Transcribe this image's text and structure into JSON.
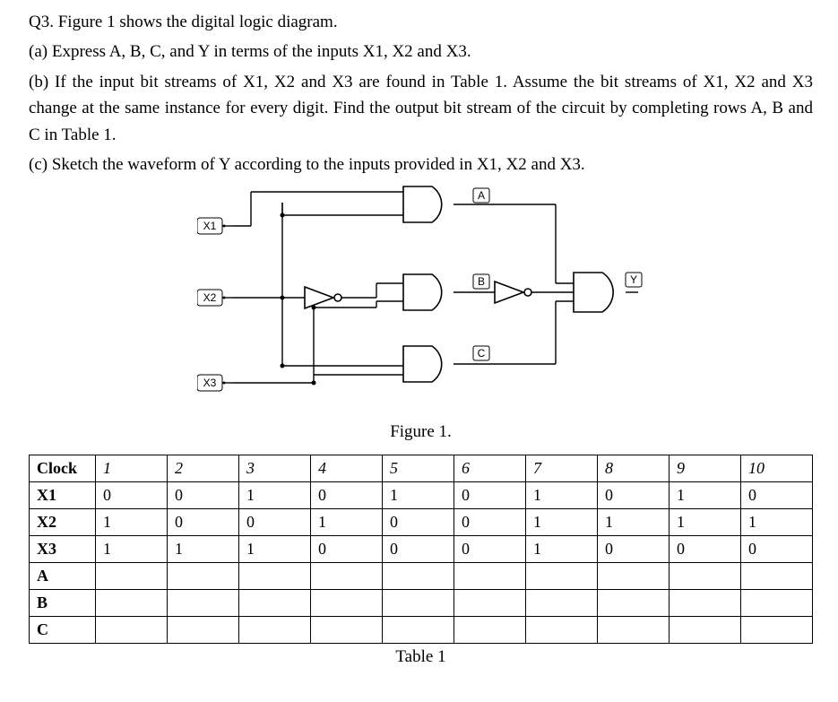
{
  "text": {
    "q_intro": "Q3. Figure 1 shows the digital logic diagram.",
    "part_a": "(a) Express A, B, C, and Y in terms of the inputs X1, X2 and X3.",
    "part_b": "(b) If the input bit streams of X1, X2 and X3 are found in Table 1. Assume the bit streams of X1, X2 and X3 change at the same instance for every digit. Find the output bit stream of the circuit by completing rows A, B and C in Table 1.",
    "part_c": "(c) Sketch the waveform of Y according to the inputs provided in X1, X2 and X3.",
    "fig_caption": "Figure 1.",
    "table_caption": "Table 1"
  },
  "diagram": {
    "inputs": {
      "x1": "X1",
      "x2": "X2",
      "x3": "X3"
    },
    "nodes": {
      "a": "A",
      "b": "B",
      "c": "C",
      "y": "Y"
    },
    "gates": {
      "not_x2": "NOT",
      "and_top": "AND2",
      "and_mid": "AND2",
      "and_bot": "AND2",
      "not_b": "NOT",
      "and_final": "AND3"
    },
    "connections_note": "A = X1·X2; B = X2'·X3; C = X2·X3; final inputs = A, B', C → Y"
  },
  "table": {
    "headers": [
      "Clock",
      "1",
      "2",
      "3",
      "4",
      "5",
      "6",
      "7",
      "8",
      "9",
      "10"
    ],
    "rows": [
      {
        "label": "X1",
        "cells": [
          "0",
          "0",
          "1",
          "0",
          "1",
          "0",
          "1",
          "0",
          "1",
          "0"
        ]
      },
      {
        "label": "X2",
        "cells": [
          "1",
          "0",
          "0",
          "1",
          "0",
          "0",
          "1",
          "1",
          "1",
          "1"
        ]
      },
      {
        "label": "X3",
        "cells": [
          "1",
          "1",
          "1",
          "0",
          "0",
          "0",
          "1",
          "0",
          "0",
          "0"
        ]
      },
      {
        "label": "A",
        "cells": [
          "",
          "",
          "",
          "",
          "",
          "",
          "",
          "",
          "",
          ""
        ]
      },
      {
        "label": "B",
        "cells": [
          "",
          "",
          "",
          "",
          "",
          "",
          "",
          "",
          "",
          ""
        ]
      },
      {
        "label": "C",
        "cells": [
          "",
          "",
          "",
          "",
          "",
          "",
          "",
          "",
          "",
          ""
        ]
      }
    ]
  }
}
